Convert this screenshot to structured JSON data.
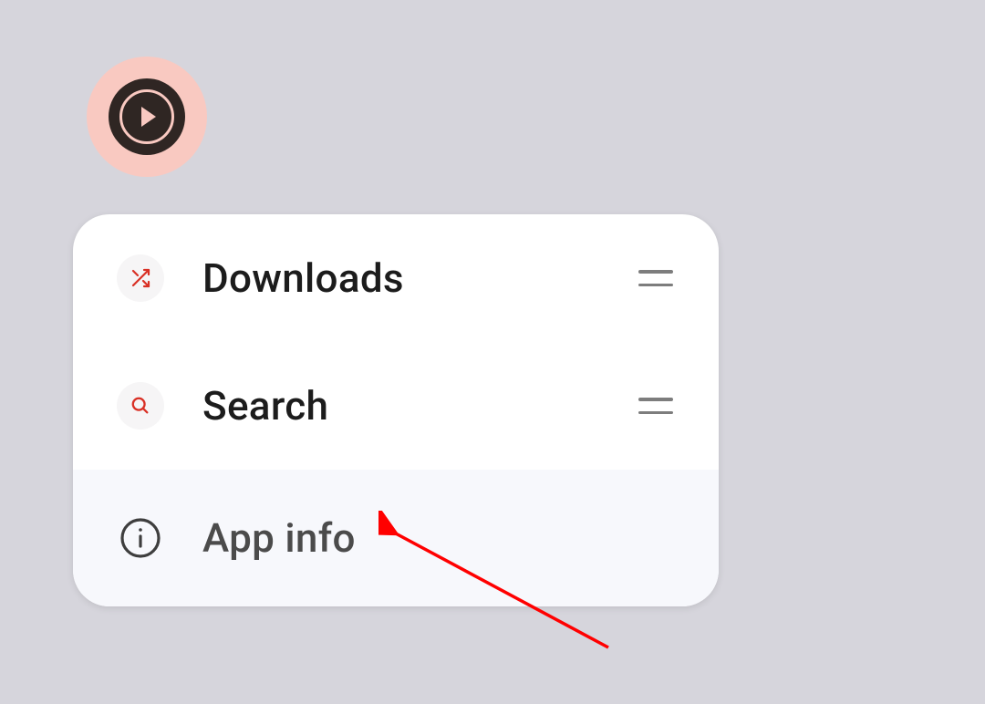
{
  "app_icon": {
    "name": "music-player-app-icon"
  },
  "menu": {
    "items": [
      {
        "label": "Downloads",
        "icon": "shuffle-icon",
        "has_handle": true
      },
      {
        "label": "Search",
        "icon": "search-icon",
        "has_handle": true
      },
      {
        "label": "App info",
        "icon": "info-icon",
        "has_handle": false
      }
    ]
  }
}
